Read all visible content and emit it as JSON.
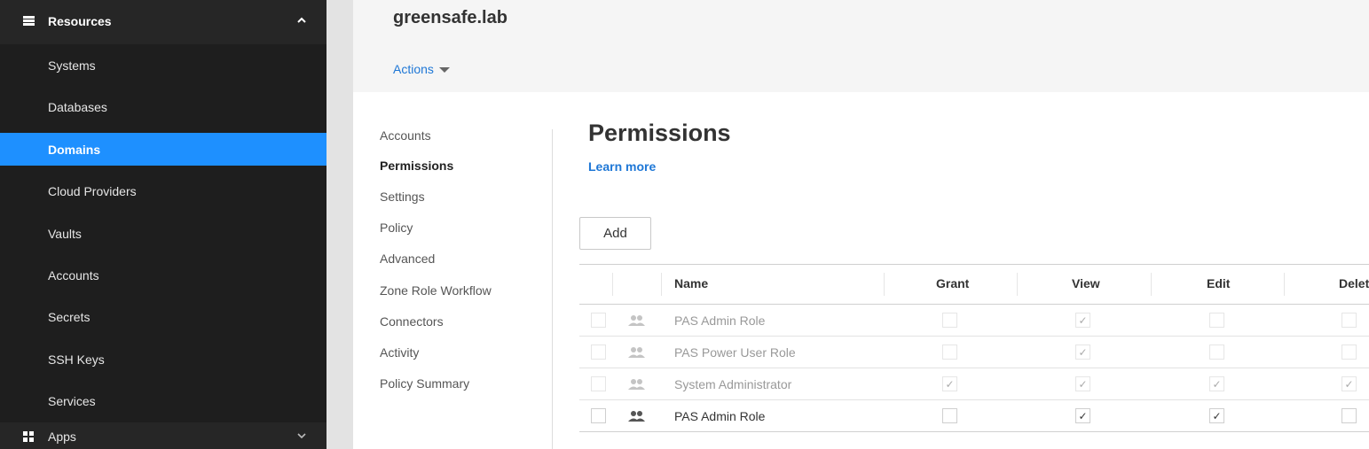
{
  "sidebar": {
    "header_label": "Resources",
    "items": [
      "Systems",
      "Databases",
      "Domains",
      "Cloud Providers",
      "Vaults",
      "Accounts",
      "Secrets",
      "SSH Keys",
      "Services"
    ],
    "active_item": "Domains",
    "apps_label": "Apps"
  },
  "header": {
    "title": "greensafe.lab",
    "actions_label": "Actions"
  },
  "tabs": [
    "Accounts",
    "Permissions",
    "Settings",
    "Policy",
    "Advanced",
    "Zone Role Workflow",
    "Connectors",
    "Activity",
    "Policy Summary"
  ],
  "active_tab": "Permissions",
  "main": {
    "title": "Permissions",
    "learn_more": "Learn more",
    "add_label": "Add"
  },
  "table": {
    "columns": [
      "Name",
      "Grant",
      "View",
      "Edit",
      "Delet"
    ],
    "rows": [
      {
        "name": "PAS Admin Role",
        "dim": true,
        "grant": false,
        "view": true,
        "edit": false,
        "delete": false
      },
      {
        "name": "PAS Power User Role",
        "dim": true,
        "grant": false,
        "view": true,
        "edit": false,
        "delete": false
      },
      {
        "name": "System Administrator",
        "dim": true,
        "grant": true,
        "view": true,
        "edit": true,
        "delete": true
      },
      {
        "name": "PAS Admin Role",
        "dim": false,
        "grant": false,
        "view": true,
        "edit": true,
        "delete": false
      }
    ]
  },
  "colors": {
    "accent": "#1e90ff",
    "link": "#1e77d6",
    "sidebar_bg": "#1e1e1e"
  },
  "icons": {
    "resources": "list-icon",
    "apps": "grid-icon",
    "role": "users-icon",
    "actions": "caret-down-icon"
  }
}
